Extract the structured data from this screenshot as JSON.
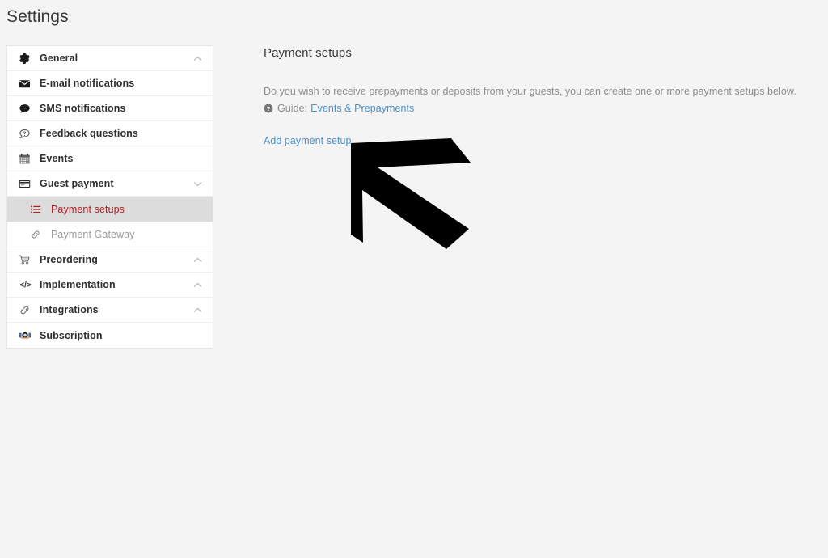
{
  "page": {
    "title": "Settings",
    "background_color": "#f4f4f4",
    "panel_color": "#ffffff"
  },
  "sidebar": {
    "items": [
      {
        "label": "General",
        "icon": "gear-icon",
        "chevron": "chevron-up",
        "type": "group"
      },
      {
        "label": "E-mail notifications",
        "icon": "envelope-icon",
        "chevron": "",
        "type": "item"
      },
      {
        "label": "SMS notifications",
        "icon": "chat-bubble-icon",
        "chevron": "",
        "type": "item"
      },
      {
        "label": "Feedback questions",
        "icon": "question-bubble-icon",
        "chevron": "",
        "type": "item"
      },
      {
        "label": "Events",
        "icon": "calendar-icon",
        "chevron": "",
        "type": "item"
      },
      {
        "label": "Guest payment",
        "icon": "credit-card-icon",
        "chevron": "chevron-down",
        "type": "group"
      }
    ],
    "sub_items": [
      {
        "label": "Payment setups",
        "icon": "list-icon",
        "state": "active",
        "color": "#b32024"
      },
      {
        "label": "Payment Gateway",
        "icon": "link-icon",
        "state": "muted",
        "color": "#9a9a9a"
      }
    ],
    "items_after": [
      {
        "label": "Preordering",
        "icon": "shopping-cart-icon",
        "chevron": "chevron-up",
        "type": "group"
      },
      {
        "label": "Implementation",
        "icon": "code-icon",
        "chevron": "chevron-up",
        "type": "group"
      },
      {
        "label": "Integrations",
        "icon": "link-icon",
        "chevron": "chevron-up",
        "type": "group"
      },
      {
        "label": "Subscription",
        "icon": "badge-icon",
        "chevron": "",
        "type": "item"
      }
    ]
  },
  "main": {
    "heading": "Payment setups",
    "description": "Do you wish to receive prepayments or deposits from your guests, you can create one or more payment setups below.",
    "guide_label": "Guide:",
    "guide_link": "Events & Prepayments",
    "add_link": "Add payment setup",
    "link_color": "#4a8fc9"
  },
  "overlay": {
    "arrow": "arrow-up-left-pointer"
  }
}
